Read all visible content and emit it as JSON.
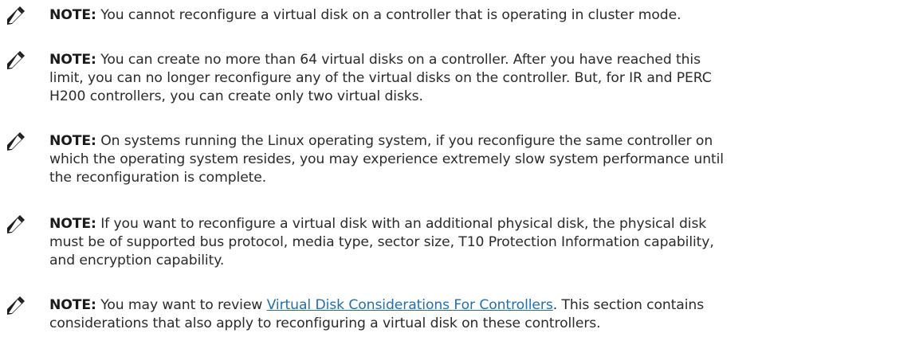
{
  "notes": [
    {
      "label": "NOTE:",
      "lines": [
        " You cannot reconfigure a virtual disk on a controller that is operating in cluster mode."
      ]
    },
    {
      "label": "NOTE:",
      "lines": [
        " You can create no more than 64 virtual disks on a controller. After you have reached this",
        "limit, you can no longer reconfigure any of the virtual disks on the controller. But, for IR and PERC",
        "H200 controllers, you can create only two virtual disks."
      ]
    },
    {
      "label": "NOTE:",
      "lines": [
        " On systems running the Linux operating system, if you reconfigure the same controller on",
        "which the operating system resides, you may experience extremely slow system performance until",
        "the reconfiguration is complete."
      ]
    },
    {
      "label": "NOTE:",
      "lines": [
        " If you want to reconfigure a virtual disk with an additional physical disk, the physical disk",
        "must be of supported bus protocol, media type, sector size, T10 Protection Information capability,",
        "and encryption capability."
      ]
    },
    {
      "label": "NOTE:",
      "lines_before_link": " You may want to review ",
      "link_text": "Virtual Disk Considerations For Controllers",
      "lines_after_link": ". This section contains",
      "lines": [
        "considerations that also apply to reconfiguring a virtual disk on these controllers."
      ]
    }
  ],
  "icon": "note-pencil-icon"
}
